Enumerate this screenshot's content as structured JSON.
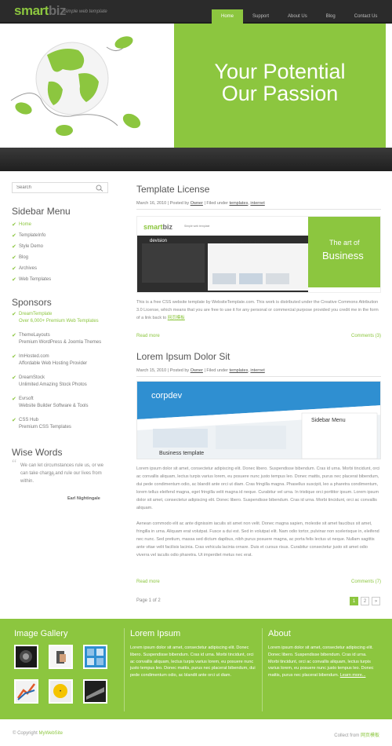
{
  "header": {
    "logo_smart": "smart",
    "logo_biz": "biz",
    "tagline": "Simple web template",
    "nav": [
      "Home",
      "Support",
      "About Us",
      "Blog",
      "Contact Us"
    ]
  },
  "hero": {
    "line1": "Your Potential",
    "line2": "Our Passion"
  },
  "sidebar": {
    "search_placeholder": "Search",
    "menu_title": "Sidebar Menu",
    "menu": [
      "Home",
      "TemplateInfo",
      "Style Demo",
      "Blog",
      "Archives",
      "Web Templates"
    ],
    "sponsors_title": "Sponsors",
    "sponsors": [
      {
        "name": "DreamTemplate",
        "desc": "Over 6,000+ Premium Web Templates"
      },
      {
        "name": "ThemeLayouts",
        "desc": "Premium WordPress & Joomla Themes"
      },
      {
        "name": "ImHosted.com",
        "desc": "Affordable Web Hosting Provider"
      },
      {
        "name": "DreamStock",
        "desc": "Unlimited Amazing Stock Photos"
      },
      {
        "name": "Evrsoft",
        "desc": "Website Builder Software & Tools"
      },
      {
        "name": "CSS Hub",
        "desc": "Premium CSS Templates"
      }
    ],
    "wise_title": "Wise Words",
    "quote": "We can let circumstances rule us, or we can take charge and rule our lives from within.",
    "quote_author": "Earl Nightingale"
  },
  "posts": [
    {
      "title": "Template License",
      "date": "March 16, 2010",
      "by": "Posted by",
      "author": "Owner",
      "filed": "Filed under",
      "tags": [
        "templates",
        "internet"
      ],
      "body": "This is a free CSS website template by WebsiteTemplate.com. This work is distributed under the Creative Commons Attribution 3.0 License, which means that you are free to use it for any personal or commercial purpose provided you credit me in the form of a link back to",
      "link": "网页模板",
      "read_more": "Read more",
      "comments": "Comments (3)",
      "image_logo_smart": "smart",
      "image_logo_biz": "biz",
      "image_tag": "Simple web template",
      "image_brand": "devision",
      "image_center": "Make best proposition",
      "image_green_small": "The art of",
      "image_green_big": "Business"
    },
    {
      "title": "Lorem Ipsum Dolor Sit",
      "date": "March 15, 2010",
      "by": "Posted by",
      "author": "Owner",
      "filed": "Filed under",
      "tags": [
        "templates",
        "internet"
      ],
      "body1": "Lorem ipsum dolor sit amet, consectetur adipiscing elit. Donec libero. Suspendisse bibendum. Cras id urna. Morbi tincidunt, orci ac convallis aliquam, lectus turpis varius lorem, eu posuere nunc justo tempus leo. Donec mattis, purus nec placerat bibendum, dui pede condimentum odio, ac blandit ante orci ut diam. Cras fringilla magna. Phasellus suscipit, leo a pharetra condimentum, lorem tellus eleifend magna, eget fringilla velit magna id neque. Curabitur vel urna. In tristique orci porttitor ipsum. Lorem ipsum dolor sit amet, consectetur adipiscing elit. Donec libero. Suspendisse bibendum. Cras id urna. Morbi tincidunt, orci ac convallis aliquam.",
      "body2": "Aenean commodo elit ac ante dignissim iaculis sit amet non velit. Donec magna sapien, molestie sit amet faucibus sit amet, fringilla in urna. Aliquam erat volutpat. Fusce a dui est. Sed in volutpat elit. Nam odio tortor, pulvinar non scelerisque in, eleifend nec nunc. Sed pretium, massa sed dictum dapibus, nibh purus posuere magna, ac porta felis lectus ut neque. Nullam sagittis ante vitae velit facilisis lacinia. Cras vehicula lacinia ornare. Duis et cursus risus. Curabitur consectetur justo sit amet odio viverra vel iaculis odio pharetra. Ut imperdiet metus nec erat.",
      "read_more": "Read more",
      "comments": "Comments (7)",
      "image_brand": "corpdev",
      "image_menu": "Sidebar Menu",
      "image_caption": "Business template"
    }
  ],
  "pagination": {
    "label": "Page 1 of 2",
    "pages": [
      "1",
      "2",
      "»"
    ]
  },
  "footer": {
    "gallery_title": "Image Gallery",
    "lorem_title": "Lorem Ipsum",
    "lorem_text": "Lorem ipsum dolor sit amet, consectetur adipiscing elit. Donec libero. Suspendisse bibendum. Cras id urna. Morbi tincidunt, orci ac convallis aliquam, lectus turpis varius lorem, eu posuere nunc justo tempus leo. Donec mattis, purus nec placerat bibendum, dui pede condimentum odio, ac blandit ante orci ut diam.",
    "about_title": "About",
    "about_text": "Lorem ipsum dolor sit amet, consectetur adipiscing elit. Donec libero. Suspendisse bibendum. Cras id urna. Morbi tincidunt, orci ac convallis aliquam, lectus turpis varius lorem, eu posuere nunc justo tempus leo. Donec mattis, purus nec placerat bibendum.",
    "learn_more": "Learn more...",
    "copyright_symbol": "©",
    "copyright": "Copyright",
    "copyright_link": "MyWebSite",
    "collect_from": "Collect from",
    "collect_link": "网页模板"
  },
  "colors": {
    "accent": "#8cc63f",
    "header_bg": "#2b2b2b",
    "text": "#777777"
  }
}
